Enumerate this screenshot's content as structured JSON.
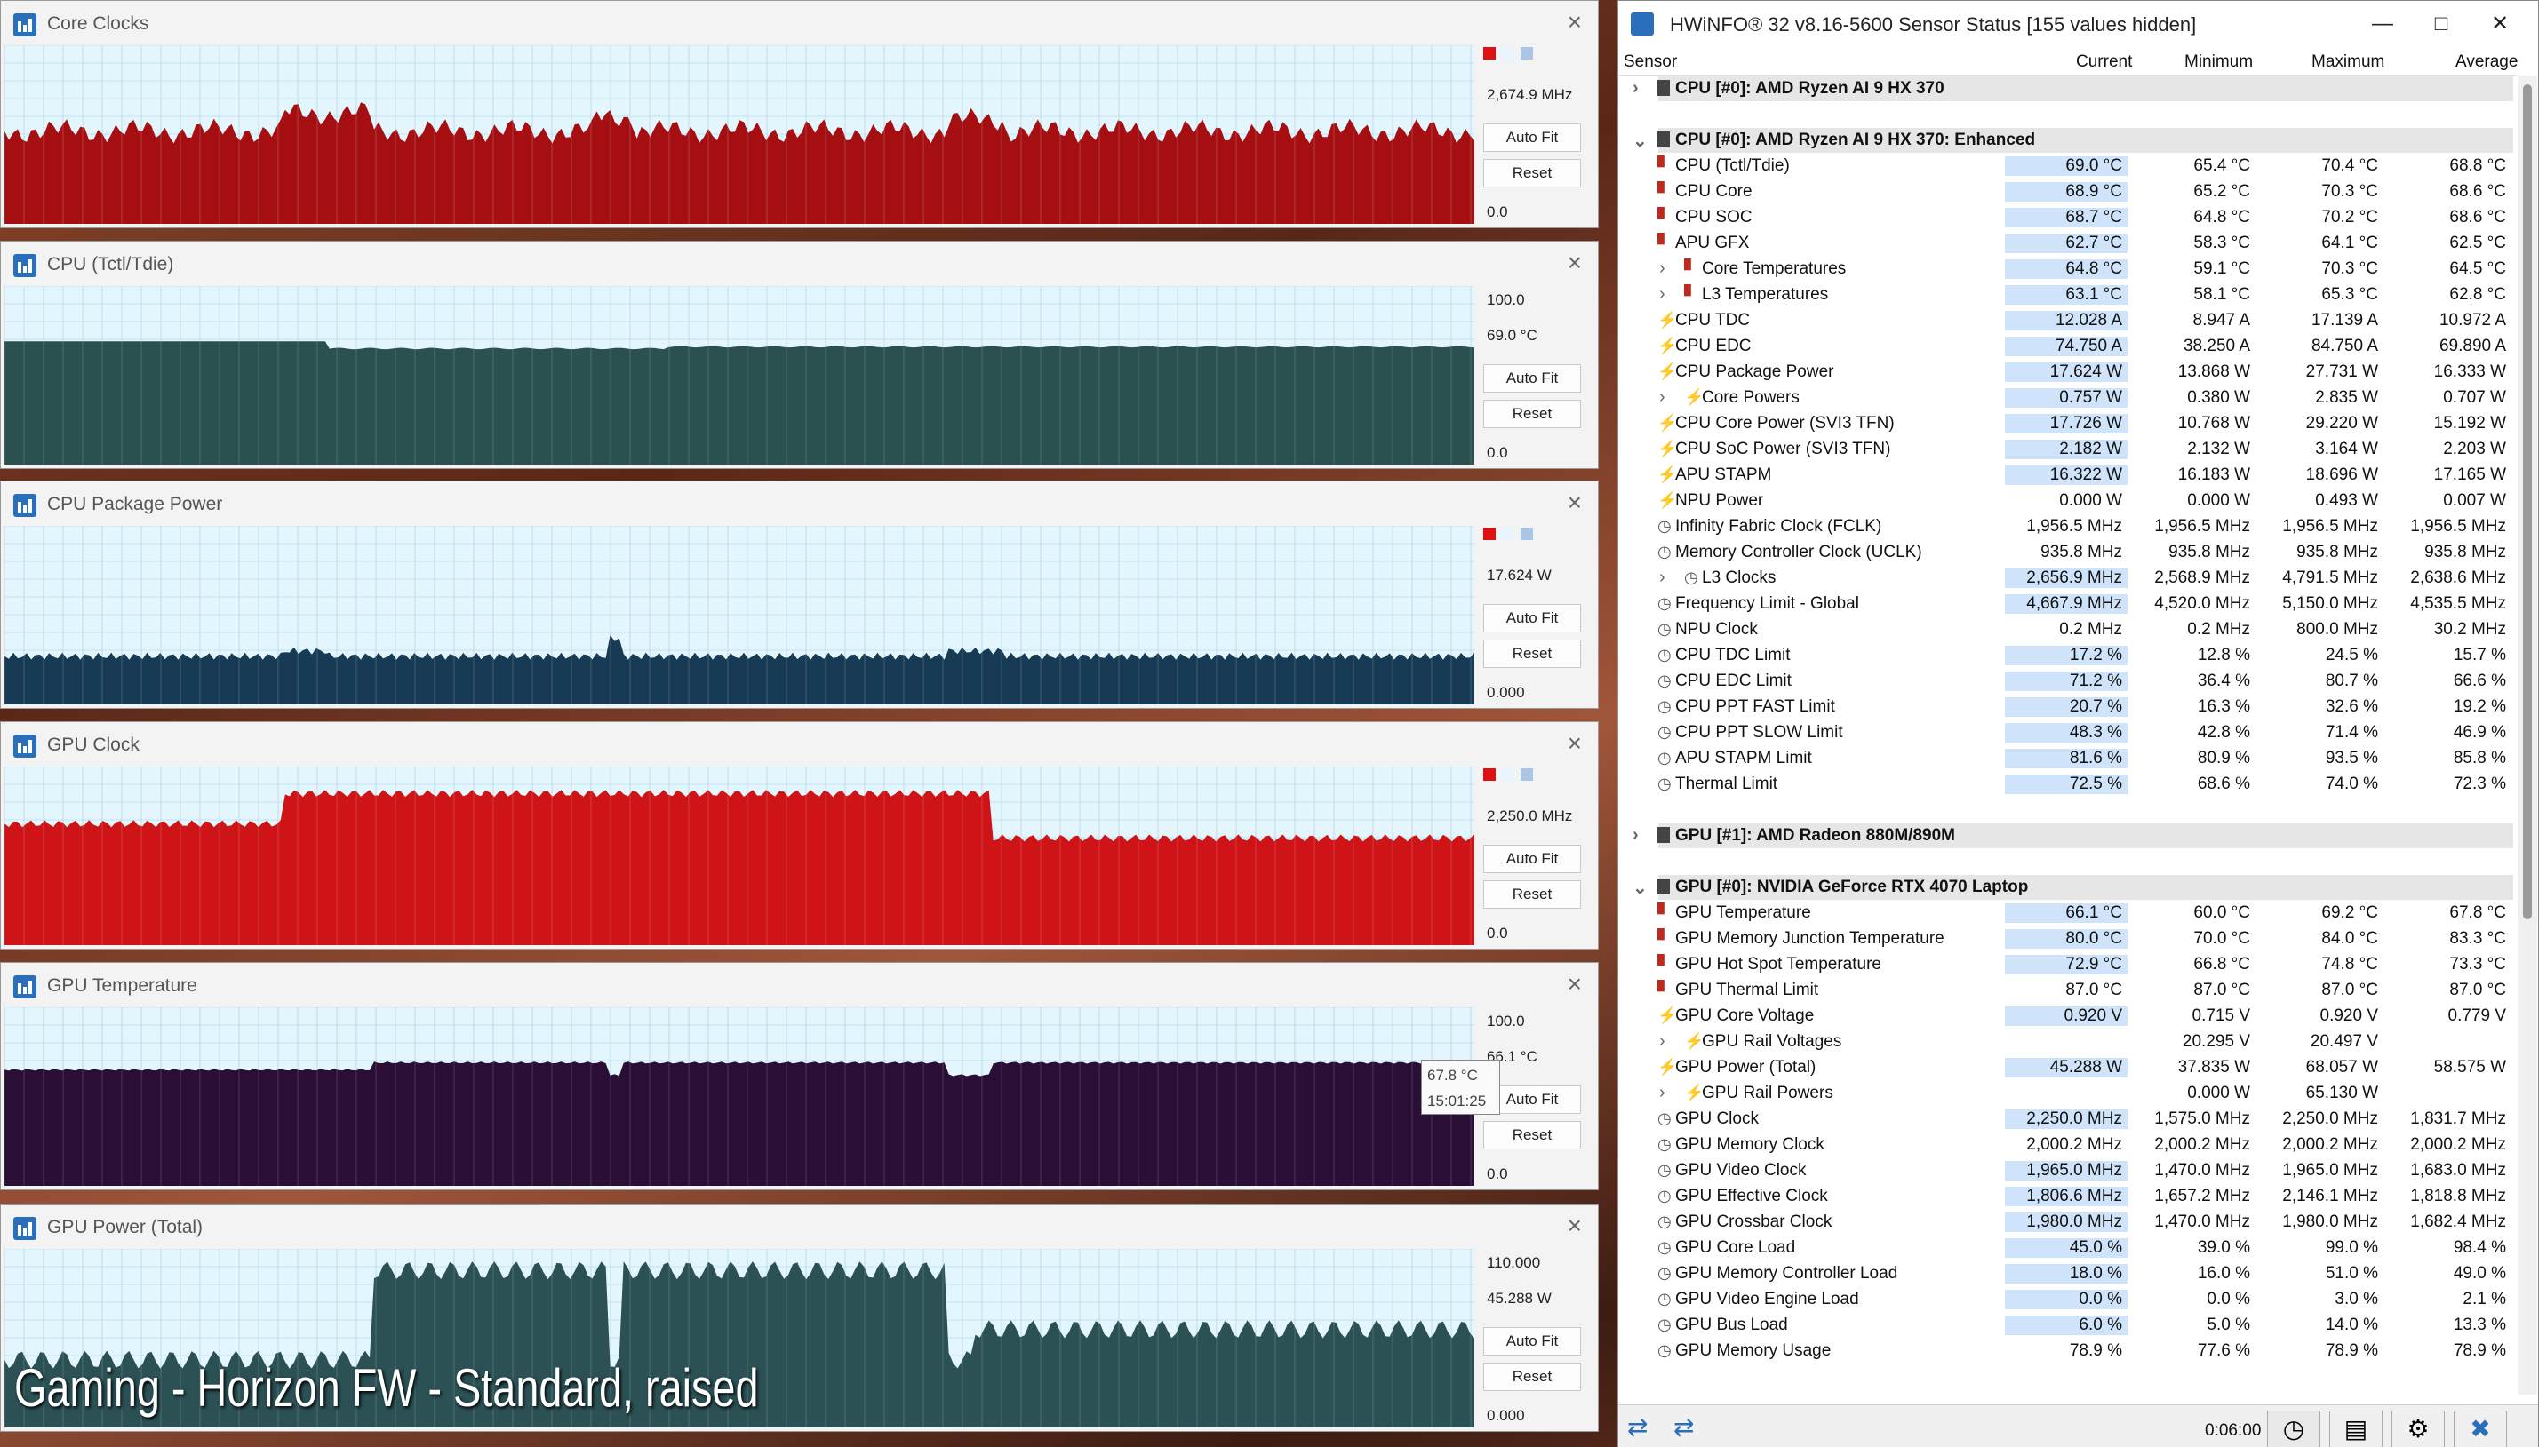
{
  "graphs": [
    {
      "title": "Core Clocks",
      "top_value": "",
      "cur_value": "2,674.9 MHz",
      "bottom_value": "0.0",
      "fill": "#a50f12",
      "grid": "#d8c4c4"
    },
    {
      "title": "CPU (Tctl/Tdie)",
      "top_value": "100.0",
      "cur_value": "69.0 °C",
      "bottom_value": "0.0",
      "fill": "#2a5150",
      "grid": "#bcd1d0"
    },
    {
      "title": "CPU Package Power",
      "top_value": "",
      "cur_value": "17.624 W",
      "bottom_value": "0.000",
      "fill": "#183b55",
      "grid": "#b5c7d5"
    },
    {
      "title": "GPU Clock",
      "top_value": "",
      "cur_value": "2,250.0 MHz",
      "bottom_value": "0.0",
      "fill": "#cf1418",
      "grid": "#e7b7b8"
    },
    {
      "title": "GPU Temperature",
      "top_value": "100.0",
      "cur_value": "66.1 °C",
      "bottom_value": "0.0",
      "fill": "#2a0e35",
      "grid": "#c0b4c6"
    },
    {
      "title": "GPU Power (Total)",
      "top_value": "110.000",
      "cur_value": "45.288 W",
      "bottom_value": "0.000",
      "fill": "#2b5155",
      "grid": "#b9cccd"
    }
  ],
  "auto_fit_label": "Auto Fit",
  "reset_label": "Reset",
  "tooltip": {
    "value": "67.8 °C",
    "time": "15:01:25"
  },
  "caption": "Gaming - Horizon FW - Standard, raised",
  "hwinfo": {
    "title": "HWiNFO® 32 v8.16-5600 Sensor Status [155 values hidden]",
    "columns": [
      "Sensor",
      "Current",
      "Minimum",
      "Maximum",
      "Average"
    ],
    "rows": [
      {
        "k": "grp",
        "e": ">",
        "n": "CPU [#0]: AMD Ryzen AI 9 HX 370"
      },
      {
        "k": "blank"
      },
      {
        "k": "grp",
        "e": "v",
        "n": "CPU [#0]: AMD Ryzen AI 9 HX 370: Enhanced"
      },
      {
        "k": "row",
        "i": "t",
        "n": "CPU (Tctl/Tdie)",
        "c": "69.0 °C",
        "mn": "65.4 °C",
        "mx": "70.4 °C",
        "av": "68.8 °C",
        "h": 1
      },
      {
        "k": "row",
        "i": "t",
        "n": "CPU Core",
        "c": "68.9 °C",
        "mn": "65.2 °C",
        "mx": "70.3 °C",
        "av": "68.6 °C",
        "h": 1
      },
      {
        "k": "row",
        "i": "t",
        "n": "CPU SOC",
        "c": "68.7 °C",
        "mn": "64.8 °C",
        "mx": "70.2 °C",
        "av": "68.6 °C",
        "h": 1
      },
      {
        "k": "row",
        "i": "t",
        "n": "APU GFX",
        "c": "62.7 °C",
        "mn": "58.3 °C",
        "mx": "64.1 °C",
        "av": "62.5 °C",
        "h": 1
      },
      {
        "k": "row",
        "i": "t",
        "s": 1,
        "n": "Core Temperatures",
        "c": "64.8 °C",
        "mn": "59.1 °C",
        "mx": "70.3 °C",
        "av": "64.5 °C",
        "h": 1
      },
      {
        "k": "row",
        "i": "t",
        "s": 1,
        "n": "L3 Temperatures",
        "c": "63.1 °C",
        "mn": "58.1 °C",
        "mx": "65.3 °C",
        "av": "62.8 °C",
        "h": 1
      },
      {
        "k": "row",
        "i": "p",
        "n": "CPU TDC",
        "c": "12.028 A",
        "mn": "8.947 A",
        "mx": "17.139 A",
        "av": "10.972 A",
        "h": 1
      },
      {
        "k": "row",
        "i": "p",
        "n": "CPU EDC",
        "c": "74.750 A",
        "mn": "38.250 A",
        "mx": "84.750 A",
        "av": "69.890 A",
        "h": 1
      },
      {
        "k": "row",
        "i": "p",
        "n": "CPU Package Power",
        "c": "17.624 W",
        "mn": "13.868 W",
        "mx": "27.731 W",
        "av": "16.333 W",
        "h": 1
      },
      {
        "k": "row",
        "i": "p",
        "s": 1,
        "n": "Core Powers",
        "c": "0.757 W",
        "mn": "0.380 W",
        "mx": "2.835 W",
        "av": "0.707 W",
        "h": 1
      },
      {
        "k": "row",
        "i": "p",
        "n": "CPU Core Power (SVI3 TFN)",
        "c": "17.726 W",
        "mn": "10.768 W",
        "mx": "29.220 W",
        "av": "15.192 W",
        "h": 1
      },
      {
        "k": "row",
        "i": "p",
        "n": "CPU SoC Power (SVI3 TFN)",
        "c": "2.182 W",
        "mn": "2.132 W",
        "mx": "3.164 W",
        "av": "2.203 W",
        "h": 1
      },
      {
        "k": "row",
        "i": "p",
        "n": "APU STAPM",
        "c": "16.322 W",
        "mn": "16.183 W",
        "mx": "18.696 W",
        "av": "17.165 W",
        "h": 1
      },
      {
        "k": "row",
        "i": "p",
        "n": "NPU Power",
        "c": "0.000 W",
        "mn": "0.000 W",
        "mx": "0.493 W",
        "av": "0.007 W",
        "h": 0
      },
      {
        "k": "row",
        "i": "c",
        "n": "Infinity Fabric Clock (FCLK)",
        "c": "1,956.5 MHz",
        "mn": "1,956.5 MHz",
        "mx": "1,956.5 MHz",
        "av": "1,956.5 MHz",
        "h": 0
      },
      {
        "k": "row",
        "i": "c",
        "n": "Memory Controller Clock (UCLK)",
        "c": "935.8 MHz",
        "mn": "935.8 MHz",
        "mx": "935.8 MHz",
        "av": "935.8 MHz",
        "h": 0
      },
      {
        "k": "row",
        "i": "c",
        "s": 1,
        "n": "L3 Clocks",
        "c": "2,656.9 MHz",
        "mn": "2,568.9 MHz",
        "mx": "4,791.5 MHz",
        "av": "2,638.6 MHz",
        "h": 1
      },
      {
        "k": "row",
        "i": "c",
        "n": "Frequency Limit - Global",
        "c": "4,667.9 MHz",
        "mn": "4,520.0 MHz",
        "mx": "5,150.0 MHz",
        "av": "4,535.5 MHz",
        "h": 1
      },
      {
        "k": "row",
        "i": "c",
        "n": "NPU Clock",
        "c": "0.2 MHz",
        "mn": "0.2 MHz",
        "mx": "800.0 MHz",
        "av": "30.2 MHz",
        "h": 0
      },
      {
        "k": "row",
        "i": "c",
        "n": "CPU TDC Limit",
        "c": "17.2 %",
        "mn": "12.8 %",
        "mx": "24.5 %",
        "av": "15.7 %",
        "h": 1
      },
      {
        "k": "row",
        "i": "c",
        "n": "CPU EDC Limit",
        "c": "71.2 %",
        "mn": "36.4 %",
        "mx": "80.7 %",
        "av": "66.6 %",
        "h": 1
      },
      {
        "k": "row",
        "i": "c",
        "n": "CPU PPT FAST Limit",
        "c": "20.7 %",
        "mn": "16.3 %",
        "mx": "32.6 %",
        "av": "19.2 %",
        "h": 1
      },
      {
        "k": "row",
        "i": "c",
        "n": "CPU PPT SLOW Limit",
        "c": "48.3 %",
        "mn": "42.8 %",
        "mx": "71.4 %",
        "av": "46.9 %",
        "h": 1
      },
      {
        "k": "row",
        "i": "c",
        "n": "APU STAPM Limit",
        "c": "81.6 %",
        "mn": "80.9 %",
        "mx": "93.5 %",
        "av": "85.8 %",
        "h": 1
      },
      {
        "k": "row",
        "i": "c",
        "n": "Thermal Limit",
        "c": "72.5 %",
        "mn": "68.6 %",
        "mx": "74.0 %",
        "av": "72.3 %",
        "h": 1
      },
      {
        "k": "blank"
      },
      {
        "k": "grp",
        "e": ">",
        "n": "GPU [#1]: AMD Radeon 880M/890M"
      },
      {
        "k": "blank"
      },
      {
        "k": "grp",
        "e": "v",
        "n": "GPU [#0]: NVIDIA GeForce RTX 4070 Laptop"
      },
      {
        "k": "row",
        "i": "t",
        "n": "GPU Temperature",
        "c": "66.1 °C",
        "mn": "60.0 °C",
        "mx": "69.2 °C",
        "av": "67.8 °C",
        "h": 1
      },
      {
        "k": "row",
        "i": "t",
        "n": "GPU Memory Junction Temperature",
        "c": "80.0 °C",
        "mn": "70.0 °C",
        "mx": "84.0 °C",
        "av": "83.3 °C",
        "h": 1
      },
      {
        "k": "row",
        "i": "t",
        "n": "GPU Hot Spot Temperature",
        "c": "72.9 °C",
        "mn": "66.8 °C",
        "mx": "74.8 °C",
        "av": "73.3 °C",
        "h": 1
      },
      {
        "k": "row",
        "i": "t",
        "n": "GPU Thermal Limit",
        "c": "87.0 °C",
        "mn": "87.0 °C",
        "mx": "87.0 °C",
        "av": "87.0 °C",
        "h": 0
      },
      {
        "k": "row",
        "i": "p",
        "n": "GPU Core Voltage",
        "c": "0.920 V",
        "mn": "0.715 V",
        "mx": "0.920 V",
        "av": "0.779 V",
        "h": 1
      },
      {
        "k": "row",
        "i": "p",
        "s": 1,
        "n": "GPU Rail Voltages",
        "c": "",
        "mn": "20.295 V",
        "mx": "20.497 V",
        "av": "",
        "h": 0
      },
      {
        "k": "row",
        "i": "p",
        "n": "GPU Power (Total)",
        "c": "45.288 W",
        "mn": "37.835 W",
        "mx": "68.057 W",
        "av": "58.575 W",
        "h": 1
      },
      {
        "k": "row",
        "i": "p",
        "s": 1,
        "n": "GPU Rail Powers",
        "c": "",
        "mn": "0.000 W",
        "mx": "65.130 W",
        "av": "",
        "h": 0
      },
      {
        "k": "row",
        "i": "c",
        "n": "GPU Clock",
        "c": "2,250.0 MHz",
        "mn": "1,575.0 MHz",
        "mx": "2,250.0 MHz",
        "av": "1,831.7 MHz",
        "h": 1
      },
      {
        "k": "row",
        "i": "c",
        "n": "GPU Memory Clock",
        "c": "2,000.2 MHz",
        "mn": "2,000.2 MHz",
        "mx": "2,000.2 MHz",
        "av": "2,000.2 MHz",
        "h": 0
      },
      {
        "k": "row",
        "i": "c",
        "n": "GPU Video Clock",
        "c": "1,965.0 MHz",
        "mn": "1,470.0 MHz",
        "mx": "1,965.0 MHz",
        "av": "1,683.0 MHz",
        "h": 1
      },
      {
        "k": "row",
        "i": "c",
        "n": "GPU Effective Clock",
        "c": "1,806.6 MHz",
        "mn": "1,657.2 MHz",
        "mx": "2,146.1 MHz",
        "av": "1,818.8 MHz",
        "h": 1
      },
      {
        "k": "row",
        "i": "c",
        "n": "GPU Crossbar Clock",
        "c": "1,980.0 MHz",
        "mn": "1,470.0 MHz",
        "mx": "1,980.0 MHz",
        "av": "1,682.4 MHz",
        "h": 1
      },
      {
        "k": "row",
        "i": "c",
        "n": "GPU Core Load",
        "c": "45.0 %",
        "mn": "39.0 %",
        "mx": "99.0 %",
        "av": "98.4 %",
        "h": 1
      },
      {
        "k": "row",
        "i": "c",
        "n": "GPU Memory Controller Load",
        "c": "18.0 %",
        "mn": "16.0 %",
        "mx": "51.0 %",
        "av": "49.0 %",
        "h": 1
      },
      {
        "k": "row",
        "i": "c",
        "n": "GPU Video Engine Load",
        "c": "0.0 %",
        "mn": "0.0 %",
        "mx": "3.0 %",
        "av": "2.1 %",
        "h": 1
      },
      {
        "k": "row",
        "i": "c",
        "n": "GPU Bus Load",
        "c": "6.0 %",
        "mn": "5.0 %",
        "mx": "14.0 %",
        "av": "13.3 %",
        "h": 1
      },
      {
        "k": "row",
        "i": "c",
        "n": "GPU Memory Usage",
        "c": "78.9 %",
        "mn": "77.6 %",
        "mx": "78.9 %",
        "av": "78.9 %",
        "h": 0
      }
    ],
    "elapsed": "0:06:00"
  }
}
